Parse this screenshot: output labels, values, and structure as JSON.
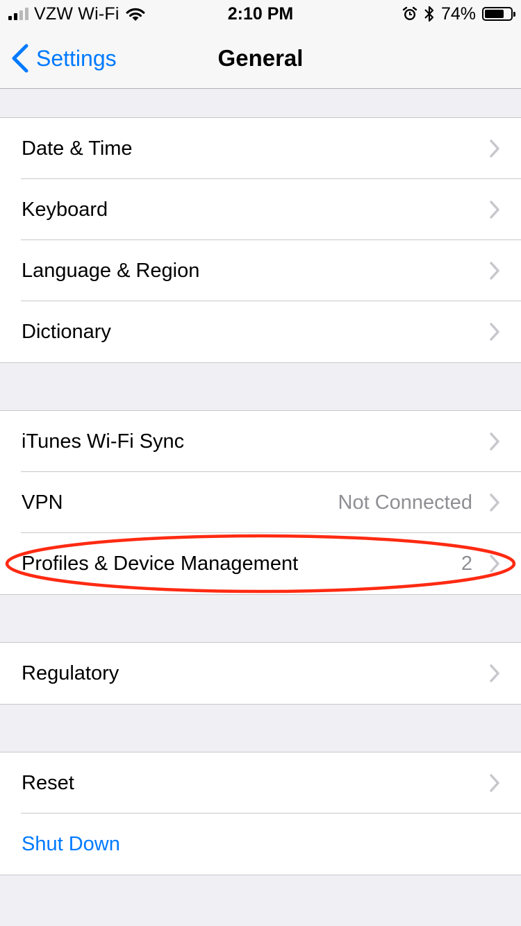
{
  "status_bar": {
    "carrier": "VZW Wi-Fi",
    "time": "2:10 PM",
    "battery_percent": "74%",
    "battery_level": 0.74,
    "signal_bars": 2,
    "signal_total": 4,
    "icons": [
      "signal-icon",
      "wifi-icon",
      "alarm-icon",
      "bluetooth-icon",
      "battery-icon"
    ]
  },
  "nav": {
    "back_label": "Settings",
    "title": "General"
  },
  "groups": [
    {
      "rows": [
        {
          "label": "Date & Time",
          "detail": ""
        },
        {
          "label": "Keyboard",
          "detail": ""
        },
        {
          "label": "Language & Region",
          "detail": ""
        },
        {
          "label": "Dictionary",
          "detail": ""
        }
      ]
    },
    {
      "rows": [
        {
          "label": "iTunes Wi-Fi Sync",
          "detail": ""
        },
        {
          "label": "VPN",
          "detail": "Not Connected"
        },
        {
          "label": "Profiles & Device Management",
          "detail": "2"
        }
      ]
    },
    {
      "rows": [
        {
          "label": "Regulatory",
          "detail": ""
        }
      ]
    },
    {
      "rows": [
        {
          "label": "Reset",
          "detail": ""
        },
        {
          "label": "Shut Down",
          "detail": ""
        }
      ]
    }
  ],
  "colors": {
    "accent": "#007aff",
    "background": "#efeff4",
    "annotation": "#ff2a12",
    "detail_text": "#8e8e93",
    "chevron": "#c7c7cc"
  },
  "annotation": {
    "shape": "ellipse",
    "highlights": "Profiles & Device Management"
  }
}
